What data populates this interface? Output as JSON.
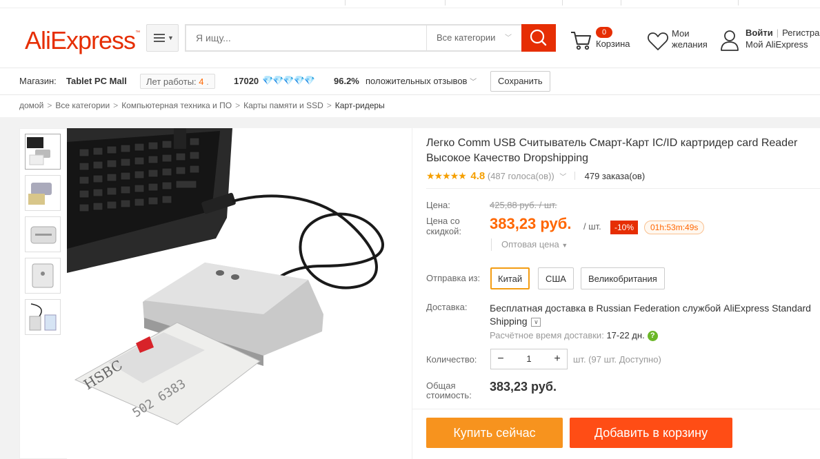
{
  "header": {
    "logo_text": "AliExpress",
    "logo_mark": "™",
    "search_placeholder": "Я ищу...",
    "category_select": "Все категории",
    "cart_count": "0",
    "cart_label": "Корзина",
    "wishlist_label": "Мои желания",
    "login_label": "Войти",
    "register_label": "Регистрация",
    "account_label": "Мой AliExpress"
  },
  "store": {
    "shop_label": "Магазин:",
    "shop_name": "Tablet PC Mall",
    "years_label": "Лет работы:",
    "years_value": "4",
    "feedback_score": "17020",
    "positive_percent": "96.2%",
    "positive_label": "положительных отзывов",
    "save_label": "Сохранить"
  },
  "breadcrumb": [
    "домой",
    "Все категории",
    "Компьютерная техника и ПО",
    "Карты памяти и SSD",
    "Карт-ридеры"
  ],
  "product": {
    "title": "Легко Comm USB Считыватель Смарт-Карт IC/ID картридер card Reader Высокое Качество Dropshipping",
    "stars": "★★★★★",
    "rating": "4.8",
    "votes": "(487 голоса(ов))",
    "orders": "479 заказа(ов)",
    "price_label": "Цена:",
    "old_price": "425,88 руб. / шт.",
    "discount_price_label": "Цена со скидкой:",
    "new_price": "383,23 руб.",
    "unit": "/ шт.",
    "discount": "-10%",
    "timer": "01h:53m:49s",
    "wholesale": "Оптовая цена",
    "ship_from_label": "Отправка из:",
    "ship_options": [
      "Китай",
      "США",
      "Великобритания"
    ],
    "delivery_label": "Доставка:",
    "delivery_text": "Бесплатная доставка в Russian Federation службой AliExpress Standard Shipping",
    "est_label": "Расчётное время доставки:",
    "est_value": "17-22 дн.",
    "qty_label": "Количество:",
    "qty_value": "1",
    "qty_available": "шт. (97 шт. Доступно)",
    "total_label": "Общая стоимость:",
    "total_value": "383,23 руб.",
    "buy_now": "Купить сейчас",
    "add_to_cart": "Добавить в корзину"
  },
  "colors": {
    "brand": "#e62e04",
    "price": "#ff6600",
    "buy_button": "#f7931e",
    "cart_button": "#ff4d15"
  }
}
